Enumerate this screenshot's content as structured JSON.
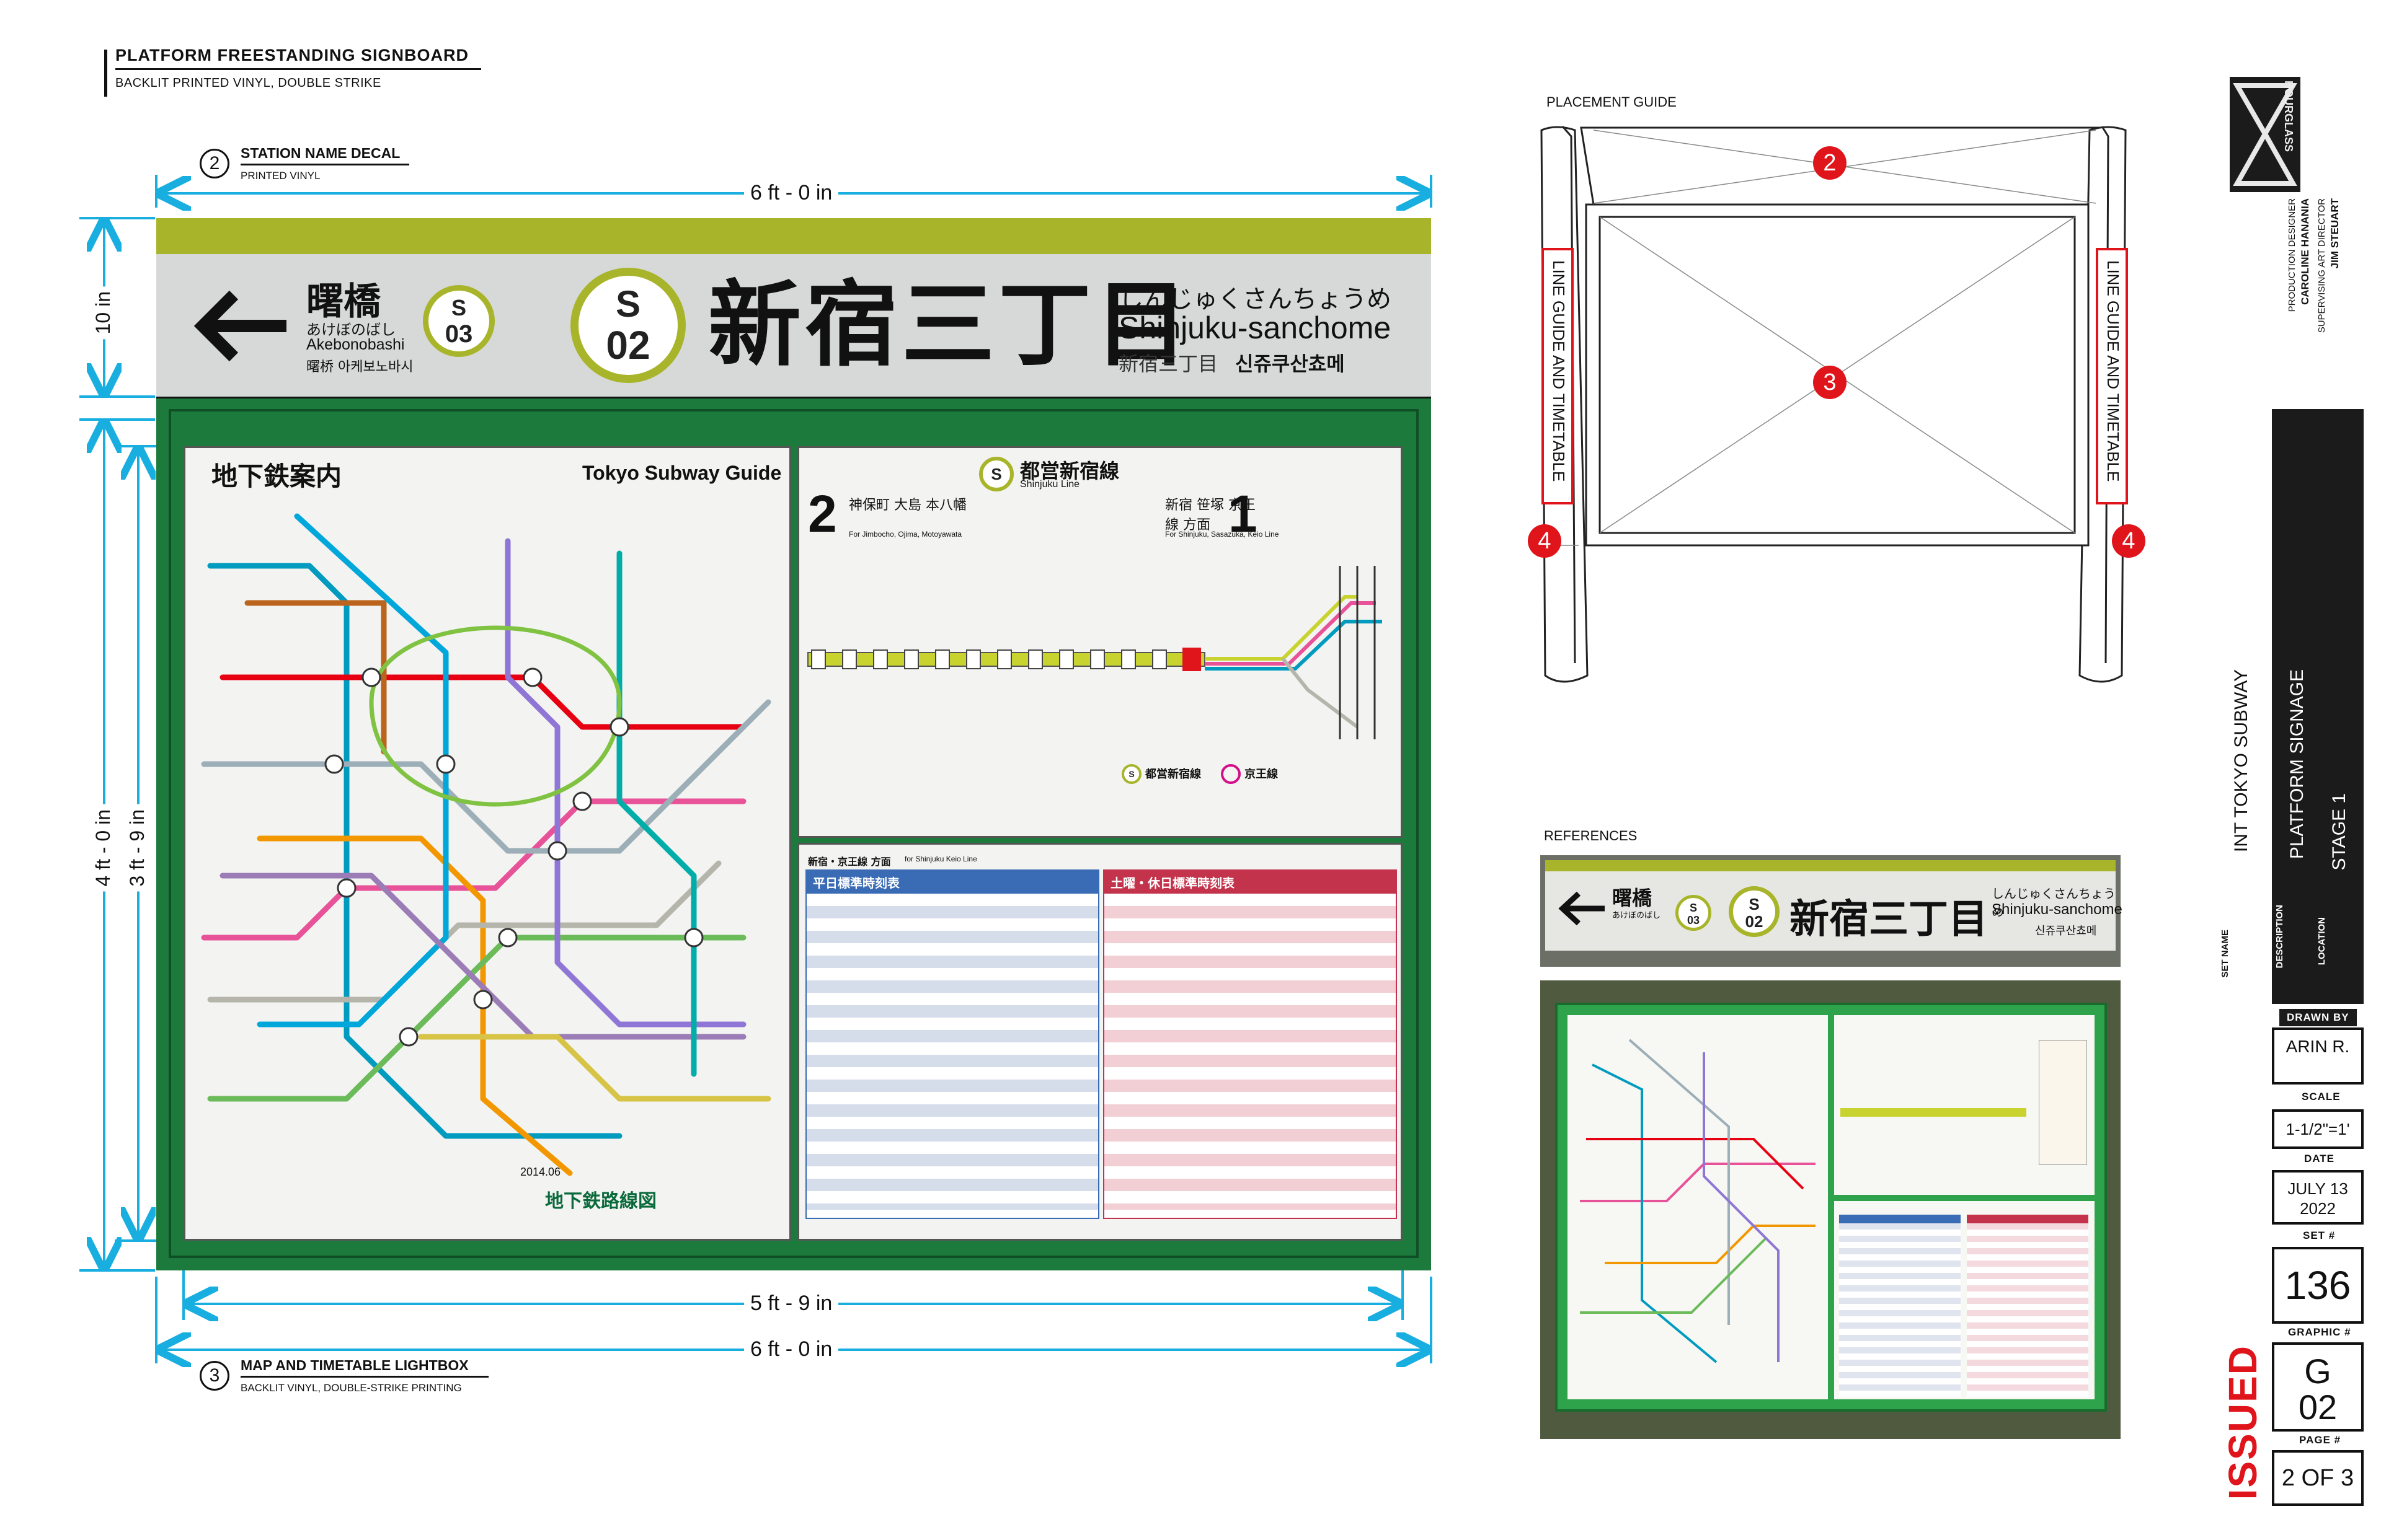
{
  "header": {
    "title": "PLATFORM FREESTANDING SIGNBOARD",
    "subtitle": "BACKLIT PRINTED VINYL, DOUBLE STRIKE"
  },
  "callout2": {
    "num": "2",
    "title": "STATION NAME DECAL",
    "sub": "PRINTED VINYL"
  },
  "callout3": {
    "num": "3",
    "title": "MAP AND TIMETABLE LIGHTBOX",
    "sub": "BACKLIT VINYL, DOUBLE-STRIKE PRINTING"
  },
  "dims": {
    "top_width": "6 ft - 0 in",
    "sign_height": "10 in",
    "box_height": "4 ft - 0 in",
    "panel_height": "3 ft - 9 in",
    "panel_width": "5 ft - 9 in",
    "bottom_width": "6 ft - 0 in"
  },
  "sign": {
    "prev_station_jp": "曙橋",
    "prev_station_kana": "あけぼのばし",
    "prev_station_en": "Akebonobashi",
    "prev_station_other": "曙桥 아케보노바시",
    "prev_code_letter": "S",
    "prev_code_num": "03",
    "code_letter": "S",
    "code_num": "02",
    "station_jp": "新宿三丁目",
    "station_kana": "しんじゅくさんちょうめ",
    "station_en": "Shinjuku-sanchome",
    "station_cn": "新宿三丁目",
    "station_kr": "신쥬쿠산쵸메",
    "colors": {
      "line": "#a8b52a",
      "frame": "#1c7a3c",
      "panel": "#d8dcd8"
    }
  },
  "map": {
    "title_jp": "地下鉄案内",
    "title_en": "Tokyo Subway Guide",
    "footer_jp": "地下鉄路線図",
    "date": "2014.06"
  },
  "line_guide": {
    "line_jp": "都営新宿線",
    "line_en": "Shinjuku Line",
    "dir2_num": "2",
    "dir2_jp": "神保町 大島 本八幡",
    "dir2_en": "For Jimbocho, Ojima, Motoyawata",
    "dir1_num": "1",
    "dir1_jp": "新宿 笹塚 京王線 方面",
    "dir1_en": "For Shinjuku, Sasazuka, Keio Line",
    "legend1": "都営新宿線",
    "legend2": "京王線"
  },
  "timetable": {
    "heading": "新宿・京王線 方面",
    "heading_en": "for Shinjuku Keio Line",
    "weekday": "平日標準時刻表",
    "weekend": "土曜・休日標準時刻表"
  },
  "placement": {
    "title": "PLACEMENT GUIDE",
    "side_label": "LINE GUIDE AND TIMETABLE",
    "c2": "2",
    "c3": "3",
    "c4": "4"
  },
  "references": {
    "title": "REFERENCES"
  },
  "titleblock": {
    "logo": "HOURGLASS",
    "designer_role": "PRODUCTION DESIGNER",
    "designer": "CAROLINE HANANIA",
    "director_role": "SUPERVISING ART DIRECTOR",
    "director": "JIM STEUART",
    "set_name_label": "SET NAME",
    "set_name": "INT TOKYO SUBWAY",
    "description_label": "DESCRIPTION",
    "description": "PLATFORM SIGNAGE",
    "location_label": "LOCATION",
    "location": "STAGE 1",
    "drawn_by_label": "DRAWN BY",
    "drawn_by": "ARIN R.",
    "scale_label": "SCALE",
    "scale": "1-1/2\"=1'",
    "date_label": "DATE",
    "date": "JULY 13 2022",
    "set_num_label": "SET #",
    "set_num": "136",
    "graphic_label": "GRAPHIC #",
    "graphic": "G 02",
    "page_label": "PAGE #",
    "page": "2 OF 3",
    "status": "ISSUED"
  }
}
